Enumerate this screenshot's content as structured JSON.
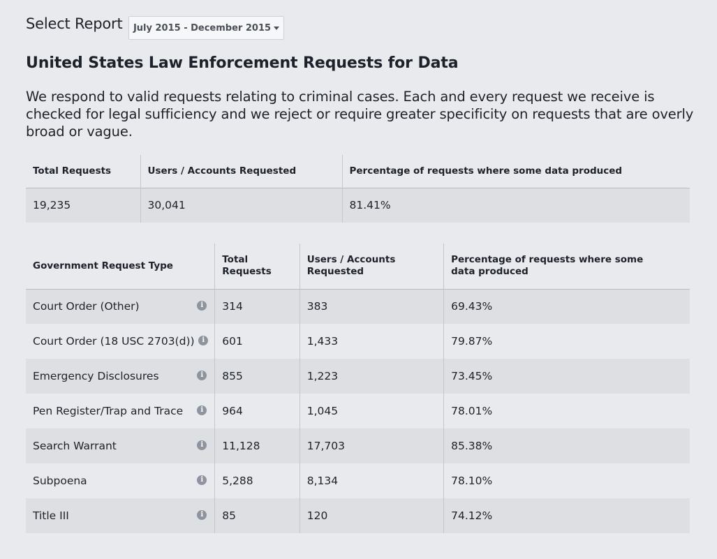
{
  "select_report": {
    "label": "Select Report",
    "selected": "July 2015 - December 2015"
  },
  "heading": "United States Law Enforcement Requests for Data",
  "intro": "We respond to valid requests relating to criminal cases. Each and every request we receive is checked for legal sufficiency and we reject or require greater specificity on requests that are overly broad or vague.",
  "summary": {
    "headers": [
      "Total Requests",
      "Users / Accounts Requested",
      "Percentage of requests where some data produced"
    ],
    "values": [
      "19,235",
      "30,041",
      "81.41%"
    ]
  },
  "detail": {
    "headers": [
      "Government Request Type",
      "Total Requests",
      "Users / Accounts Requested",
      "Percentage of requests where some data produced"
    ],
    "rows": [
      {
        "type": "Court Order (Other)",
        "total": "314",
        "users": "383",
        "percent": "69.43%"
      },
      {
        "type": "Court Order (18 USC 2703(d))",
        "total": "601",
        "users": "1,433",
        "percent": "79.87%"
      },
      {
        "type": "Emergency Disclosures",
        "total": "855",
        "users": "1,223",
        "percent": "73.45%"
      },
      {
        "type": "Pen Register/Trap and Trace",
        "total": "964",
        "users": "1,045",
        "percent": "78.01%"
      },
      {
        "type": "Search Warrant",
        "total": "11,128",
        "users": "17,703",
        "percent": "85.38%"
      },
      {
        "type": "Subpoena",
        "total": "5,288",
        "users": "8,134",
        "percent": "78.10%"
      },
      {
        "type": "Title III",
        "total": "85",
        "users": "120",
        "percent": "74.12%"
      }
    ],
    "info_icon": "info-icon",
    "info_glyph": "i"
  }
}
